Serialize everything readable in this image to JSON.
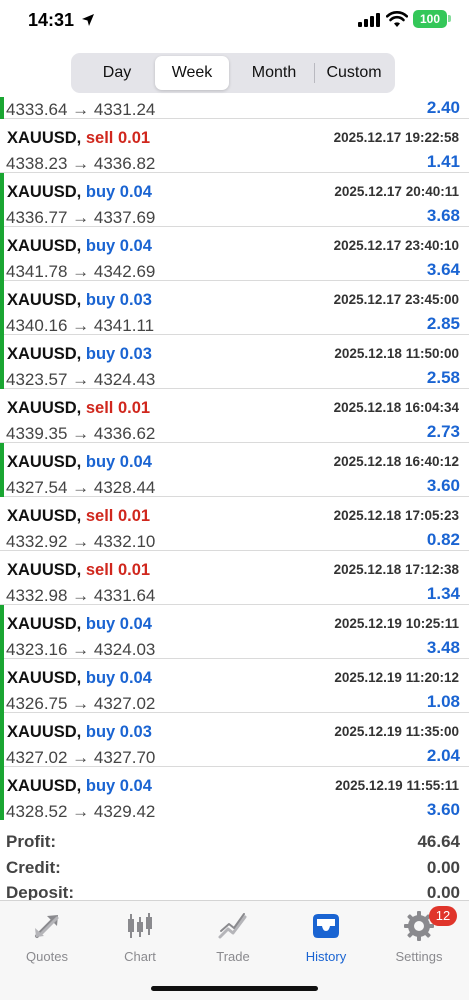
{
  "status_bar": {
    "time": "14:31",
    "battery": "100"
  },
  "period_tabs": [
    {
      "label": "Day",
      "active": false
    },
    {
      "label": "Week",
      "active": true
    },
    {
      "label": "Month",
      "active": false
    },
    {
      "label": "Custom",
      "active": false
    }
  ],
  "partial_row": {
    "prices": "4333.64 → 4331.24",
    "profit": "2.40"
  },
  "deals": [
    {
      "symbol": "XAUUSD,",
      "direction": "sell",
      "volume": "sell 0.01",
      "prices": "4338.23 → 4336.82",
      "time": "2025.12.17 19:22:58",
      "profit": "1.41"
    },
    {
      "symbol": "XAUUSD,",
      "direction": "buy",
      "volume": "buy 0.04",
      "prices": "4336.77 → 4337.69",
      "time": "2025.12.17 20:40:11",
      "profit": "3.68"
    },
    {
      "symbol": "XAUUSD,",
      "direction": "buy",
      "volume": "buy 0.04",
      "prices": "4341.78 → 4342.69",
      "time": "2025.12.17 23:40:10",
      "profit": "3.64"
    },
    {
      "symbol": "XAUUSD,",
      "direction": "buy",
      "volume": "buy 0.03",
      "prices": "4340.16 → 4341.11",
      "time": "2025.12.17 23:45:00",
      "profit": "2.85"
    },
    {
      "symbol": "XAUUSD,",
      "direction": "buy",
      "volume": "buy 0.03",
      "prices": "4323.57 → 4324.43",
      "time": "2025.12.18 11:50:00",
      "profit": "2.58"
    },
    {
      "symbol": "XAUUSD,",
      "direction": "sell",
      "volume": "sell 0.01",
      "prices": "4339.35 → 4336.62",
      "time": "2025.12.18 16:04:34",
      "profit": "2.73"
    },
    {
      "symbol": "XAUUSD,",
      "direction": "buy",
      "volume": "buy 0.04",
      "prices": "4327.54 → 4328.44",
      "time": "2025.12.18 16:40:12",
      "profit": "3.60"
    },
    {
      "symbol": "XAUUSD,",
      "direction": "sell",
      "volume": "sell 0.01",
      "prices": "4332.92 → 4332.10",
      "time": "2025.12.18 17:05:23",
      "profit": "0.82"
    },
    {
      "symbol": "XAUUSD,",
      "direction": "sell",
      "volume": "sell 0.01",
      "prices": "4332.98 → 4331.64",
      "time": "2025.12.18 17:12:38",
      "profit": "1.34"
    },
    {
      "symbol": "XAUUSD,",
      "direction": "buy",
      "volume": "buy 0.04",
      "prices": "4323.16 → 4324.03",
      "time": "2025.12.19 10:25:11",
      "profit": "3.48"
    },
    {
      "symbol": "XAUUSD,",
      "direction": "buy",
      "volume": "buy 0.04",
      "prices": "4326.75 → 4327.02",
      "time": "2025.12.19 11:20:12",
      "profit": "1.08"
    },
    {
      "symbol": "XAUUSD,",
      "direction": "buy",
      "volume": "buy 0.03",
      "prices": "4327.02 → 4327.70",
      "time": "2025.12.19 11:35:00",
      "profit": "2.04"
    },
    {
      "symbol": "XAUUSD,",
      "direction": "buy",
      "volume": "buy 0.04",
      "prices": "4328.52 → 4329.42",
      "time": "2025.12.19 11:55:11",
      "profit": "3.60"
    }
  ],
  "summary": [
    {
      "label": "Profit:",
      "value": "46.64"
    },
    {
      "label": "Credit:",
      "value": "0.00"
    },
    {
      "label": "Deposit:",
      "value": "0.00"
    }
  ],
  "tabbar": [
    {
      "label": "Quotes",
      "icon": "quotes-icon",
      "active": false
    },
    {
      "label": "Chart",
      "icon": "chart-candles-icon",
      "active": false
    },
    {
      "label": "Trade",
      "icon": "trade-icon",
      "active": false
    },
    {
      "label": "History",
      "icon": "history-inbox-icon",
      "active": true
    },
    {
      "label": "Settings",
      "icon": "gear-icon",
      "active": false
    }
  ],
  "settings_badge": "12",
  "colors": {
    "buy": "#1a64d2",
    "sell": "#d0271d",
    "buy_bar": "#1aa632",
    "profit": "#1a64d2",
    "active_tab": "#1a64d2",
    "battery": "#34c759",
    "badge": "#e0352b"
  }
}
